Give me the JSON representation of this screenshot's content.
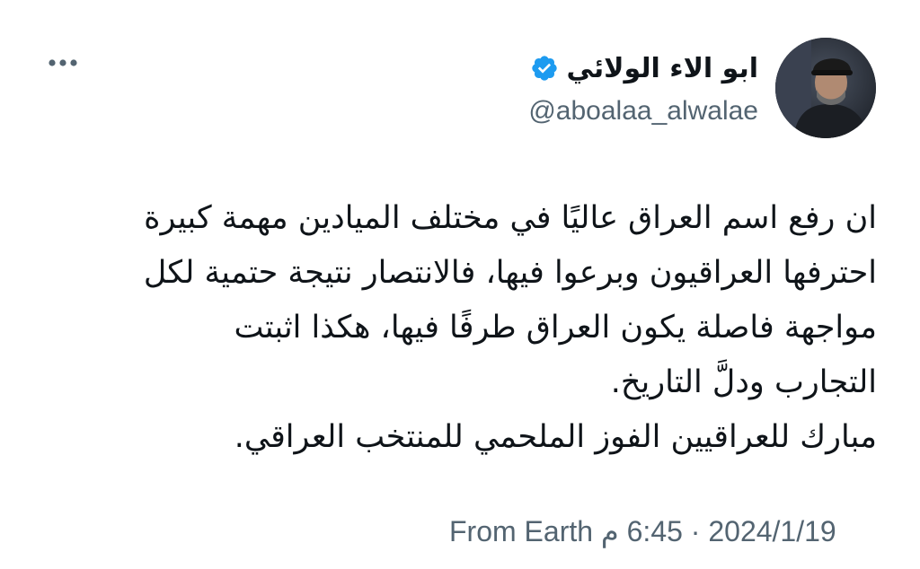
{
  "tweet": {
    "author": {
      "display_name": "ابو الاء الولائي",
      "handle": "@aboalaa_alwalae",
      "verified": true,
      "avatar_icon": "profile-photo"
    },
    "more_icon": "more-dots-icon",
    "text_lines": [
      "ان رفع اسم العراق عاليًا في مختلف الميادين مهمة كبيرة",
      "احترفها العراقيون وبرعوا فيها، فالانتصار نتيجة حتمية لكل",
      "مواجهة فاصلة يكون العراق طرفًا فيها، هكذا اثبتت",
      "التجارب ودلَّ التاريخ.",
      "مبارك للعراقيين الفوز الملحمي للمنتخب العراقي."
    ],
    "meta": {
      "source": "From Earth",
      "time": "6:45 م",
      "separator": "·",
      "date": "2024/1/19"
    },
    "colors": {
      "text": "#0f1419",
      "secondary": "#536471",
      "verified": "#1d9bf0",
      "background": "#ffffff"
    }
  }
}
